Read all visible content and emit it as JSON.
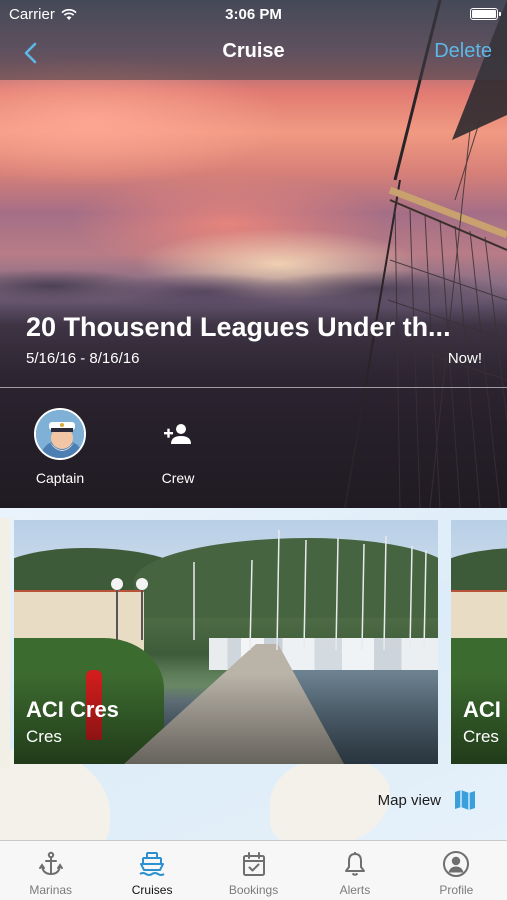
{
  "status_bar": {
    "carrier": "Carrier",
    "time": "3:06 PM"
  },
  "nav": {
    "title": "Cruise",
    "delete_label": "Delete"
  },
  "trip": {
    "title": "20 Thousend Leagues Under th...",
    "dates": "5/16/16 - 8/16/16",
    "status": "Now!"
  },
  "people": {
    "captain_label": "Captain",
    "crew_label": "Crew"
  },
  "marinas": [
    {
      "name": "ACI Cres",
      "location": "Cres"
    },
    {
      "name": "ACI",
      "location": "Cres"
    }
  ],
  "map": {
    "view_label": "Map view"
  },
  "tabs": [
    {
      "label": "Marinas",
      "icon": "anchor-icon"
    },
    {
      "label": "Cruises",
      "icon": "ship-icon"
    },
    {
      "label": "Bookings",
      "icon": "calendar-check-icon"
    },
    {
      "label": "Alerts",
      "icon": "bell-icon"
    },
    {
      "label": "Profile",
      "icon": "person-circle-icon"
    }
  ],
  "colors": {
    "accent": "#2a90d0",
    "delete": "#5cb8e6",
    "tab_inactive": "#7b7b7b"
  },
  "active_tab": "Cruises"
}
